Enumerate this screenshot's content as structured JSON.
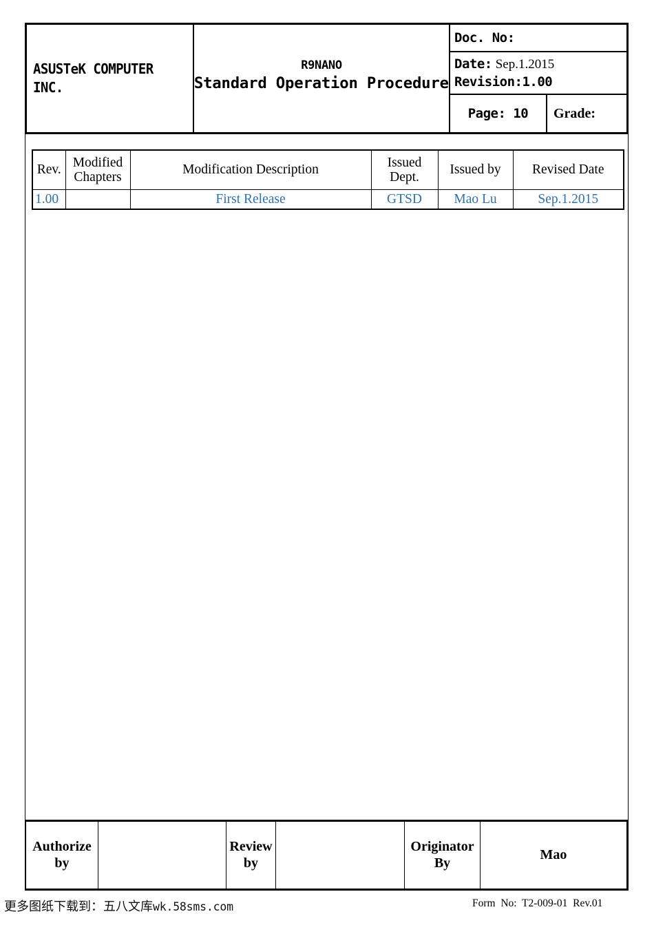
{
  "header": {
    "company": "ASUSTeK COMPUTER\nINC.",
    "title_sub": "R9NANO",
    "title_main": "Standard Operation Procedure",
    "doc_no_label": "Doc. No:",
    "doc_no_value": "",
    "date_label": "Date:",
    "date_value": "Sep.1.2015",
    "revision_line": "Revision:1.00",
    "page_label": "Page: 10",
    "grade_label": "Grade:"
  },
  "revision_table": {
    "columns": [
      "Rev.",
      "Modified\nChapters",
      "Modification Description",
      "Issued\nDept.",
      "Issued by",
      "Revised Date"
    ],
    "rows": [
      {
        "rev": "1.00",
        "modified_chapters": "",
        "description": "First Release",
        "issued_dept": "GTSD",
        "issued_by": "Mao Lu",
        "revised_date": "Sep.1.2015"
      }
    ],
    "row_text_color": "#2d72ad"
  },
  "signature_row": {
    "authorize_label": "Authorize\nby",
    "authorize_value": "",
    "review_label": "Review\nby",
    "review_value": "",
    "originator_label": "Originator\nBy",
    "originator_value": "Mao"
  },
  "footer": {
    "watermark_cn": "更多图纸下载到：五八文库",
    "watermark_url": "wk.58sms.com",
    "form_no": "Form  No:  T2-009-01  Rev.01"
  }
}
